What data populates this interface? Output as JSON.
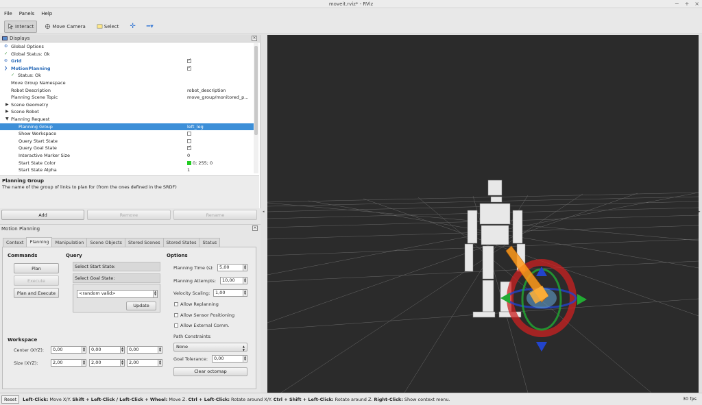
{
  "window": {
    "title": "moveit.rviz* - RViz",
    "controls": [
      "−",
      "+",
      "×"
    ]
  },
  "menu": [
    "File",
    "Panels",
    "Help"
  ],
  "toolbar": {
    "interact": "Interact",
    "move_camera": "Move Camera",
    "select": "Select"
  },
  "displays": {
    "title": "Displays",
    "rows": [
      {
        "label": "Global Options",
        "value": "",
        "indent": 1,
        "icon": "gear-icon"
      },
      {
        "label": "Global Status: Ok",
        "value": "",
        "indent": 1,
        "icon": "check-icon"
      },
      {
        "label": "Grid",
        "value": "",
        "indent": 1,
        "icon": "grid-icon",
        "checked": true,
        "blue": true
      },
      {
        "label": "MotionPlanning",
        "value": "",
        "indent": 1,
        "icon": "motion-icon",
        "checked": true,
        "blue": true
      },
      {
        "label": "Status: Ok",
        "value": "",
        "indent": 2,
        "icon": "check-icon"
      },
      {
        "label": "Move Group Namespace",
        "value": "",
        "indent": 2
      },
      {
        "label": "Robot Description",
        "value": "robot_description",
        "indent": 2
      },
      {
        "label": "Planning Scene Topic",
        "value": "move_group/monitored_p...",
        "indent": 2
      },
      {
        "label": "Scene Geometry",
        "value": "",
        "indent": 2,
        "arrow": "▶"
      },
      {
        "label": "Scene Robot",
        "value": "",
        "indent": 2,
        "arrow": "▶"
      },
      {
        "label": "Planning Request",
        "value": "",
        "indent": 2,
        "arrow": "▼"
      },
      {
        "label": "Planning Group",
        "value": "left_leg",
        "indent": 3,
        "selected": true
      },
      {
        "label": "Show Workspace",
        "value": "",
        "indent": 3,
        "checked": false
      },
      {
        "label": "Query Start State",
        "value": "",
        "indent": 3,
        "checked": false
      },
      {
        "label": "Query Goal State",
        "value": "",
        "indent": 3,
        "checked": true
      },
      {
        "label": "Interactive Marker Size",
        "value": "0",
        "indent": 3
      },
      {
        "label": "Start State Color",
        "value": "0; 255; 0",
        "indent": 3,
        "swatch": "#22cc22"
      },
      {
        "label": "Start State Alpha",
        "value": "1",
        "indent": 3
      }
    ],
    "desc_title": "Planning Group",
    "desc_text": "The name of the group of links to plan for (from the ones defined in the SRDF)"
  },
  "panel_buttons": {
    "add": "Add",
    "remove": "Remove",
    "rename": "Rename"
  },
  "motion_planning": {
    "title": "Motion Planning",
    "tabs": [
      "Context",
      "Planning",
      "Manipulation",
      "Scene Objects",
      "Stored Scenes",
      "Stored States",
      "Status"
    ],
    "active_tab": "Planning",
    "commands": {
      "title": "Commands",
      "plan": "Plan",
      "execute": "Execute",
      "plan_execute": "Plan and Execute"
    },
    "query": {
      "title": "Query",
      "start": "Select Start State:",
      "goal": "Select Goal State:",
      "goal_value": "<random valid>",
      "update": "Update"
    },
    "options": {
      "title": "Options",
      "planning_time_label": "Planning Time (s):",
      "planning_time": "5,00",
      "planning_attempts_label": "Planning Attempts:",
      "planning_attempts": "10,00",
      "velocity_label": "Velocity Scaling:",
      "velocity": "1,00",
      "allow_replanning": "Allow Replanning",
      "allow_sensor": "Allow Sensor Positioning",
      "allow_external": "Allow External Comm.",
      "path_constraints_label": "Path Constraints:",
      "path_constraints": "None",
      "goal_tolerance_label": "Goal Tolerance:",
      "goal_tolerance": "0,00",
      "clear_octomap": "Clear octomap"
    },
    "workspace": {
      "title": "Workspace",
      "center_label": "Center (XYZ):",
      "center": [
        "0,00",
        "0,00",
        "0,00"
      ],
      "size_label": "Size (XYZ):",
      "size": [
        "2,00",
        "2,00",
        "2,00"
      ]
    }
  },
  "status": {
    "reset": "Reset",
    "hint_parts": [
      {
        "b": "Left-Click:",
        "t": " Move X/Y. "
      },
      {
        "b": "Shift + Left-Click / Left-Click + Wheel:",
        "t": " Move Z. "
      },
      {
        "b": "Ctrl + Left-Click:",
        "t": " Rotate around X/Y. "
      },
      {
        "b": "Ctrl + Shift + Left-Click:",
        "t": " Rotate around Z. "
      },
      {
        "b": "Right-Click:",
        "t": " Show context menu."
      }
    ],
    "fps": "30 fps"
  }
}
